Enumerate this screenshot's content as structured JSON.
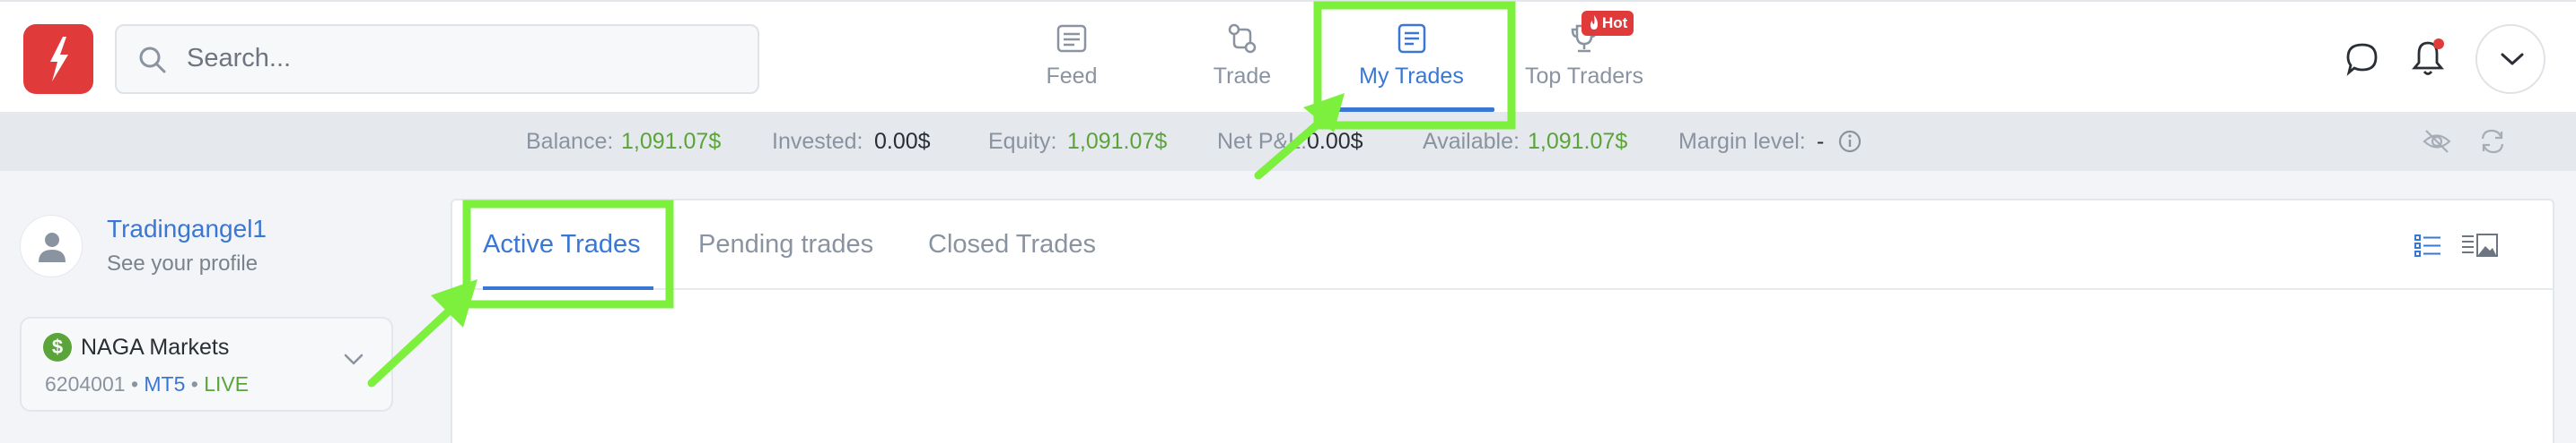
{
  "app": {
    "brand_color": "#e13a3a",
    "accent_color": "#3a77d4",
    "positive_color": "#5aa43a",
    "annotation_color": "#7cf03c"
  },
  "search": {
    "placeholder": "Search..."
  },
  "nav": {
    "items": [
      {
        "label": "Feed",
        "icon": "feed-icon",
        "active": false
      },
      {
        "label": "Trade",
        "icon": "trade-icon",
        "active": false
      },
      {
        "label": "My Trades",
        "icon": "my-trades-icon",
        "active": true
      },
      {
        "label": "Top Traders",
        "icon": "trophy-icon",
        "active": false,
        "badge": "Hot"
      }
    ]
  },
  "header_icons": [
    "chat-icon",
    "bell-icon",
    "chevron-down-icon"
  ],
  "balance_bar": {
    "balance_label": "Balance:",
    "balance_value": "1,091.07$",
    "invested_label": "Invested:",
    "invested_value": "0.00$",
    "equity_label": "Equity:",
    "equity_value": "1,091.07$",
    "netpl_label": "Net P&L:",
    "netpl_value": "0.00$",
    "available_label": "Available:",
    "available_value": "1,091.07$",
    "margin_label": "Margin level:",
    "margin_value": "-",
    "icons": [
      "info-icon",
      "eye-off-icon",
      "refresh-icon"
    ]
  },
  "profile": {
    "name": "Tradingangel1",
    "subtitle": "See your profile"
  },
  "account": {
    "name": "NAGA Markets",
    "number": "6204001",
    "platform": "MT5",
    "mode": "LIVE",
    "separator": "•"
  },
  "trades": {
    "tabs": [
      {
        "label": "Active Trades",
        "active": true
      },
      {
        "label": "Pending trades",
        "active": false
      },
      {
        "label": "Closed Trades",
        "active": false
      }
    ],
    "view_icons": [
      "list-view-icon",
      "card-view-icon"
    ]
  }
}
